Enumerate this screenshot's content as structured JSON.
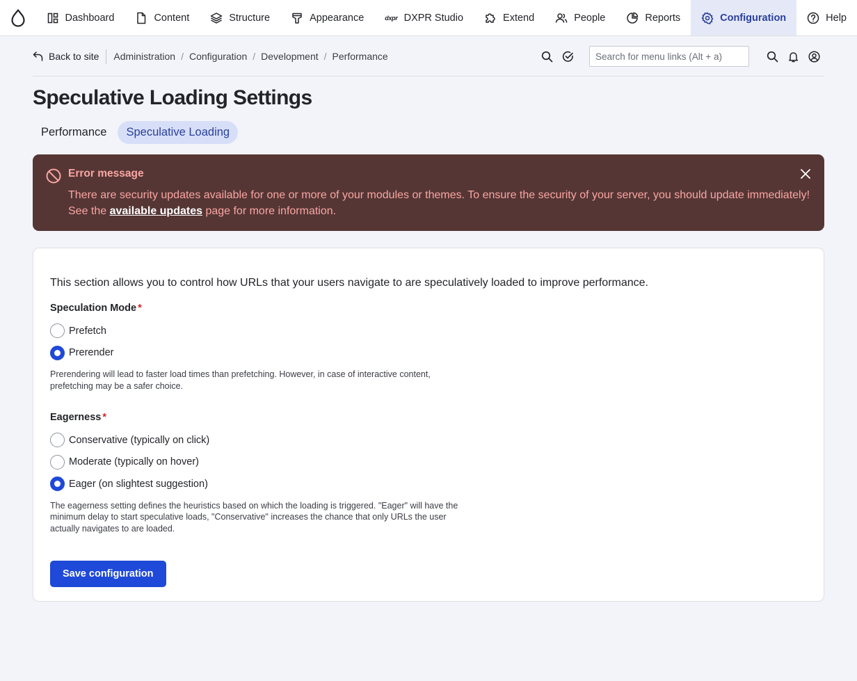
{
  "toolbar": {
    "logo_icon": "drupal-drop-icon",
    "items": [
      {
        "label": "Dashboard",
        "icon": "dashboard-icon"
      },
      {
        "label": "Content",
        "icon": "file-icon"
      },
      {
        "label": "Structure",
        "icon": "layers-icon"
      },
      {
        "label": "Appearance",
        "icon": "brush-icon"
      },
      {
        "label": "DXPR Studio",
        "icon": "dxpr-icon",
        "glyph": "dxpr"
      },
      {
        "label": "Extend",
        "icon": "puzzle-icon"
      },
      {
        "label": "People",
        "icon": "people-icon"
      },
      {
        "label": "Reports",
        "icon": "pie-chart-icon"
      },
      {
        "label": "Configuration",
        "icon": "gear-icon",
        "active": true
      },
      {
        "label": "Help",
        "icon": "help-icon"
      }
    ]
  },
  "breadcrumb": {
    "back_label": "Back to site",
    "items": [
      "Administration",
      "Configuration",
      "Development",
      "Performance"
    ],
    "search_placeholder": "Search for menu links (Alt + a)"
  },
  "page": {
    "title": "Speculative Loading Settings",
    "tabs": [
      {
        "label": "Performance",
        "active": false
      },
      {
        "label": "Speculative Loading",
        "active": true
      }
    ]
  },
  "alert": {
    "title": "Error message",
    "body_before": "There are security updates available for one or more of your modules or themes. To ensure the security of your server, you should update imme­diately! See the ",
    "link_text": "available updates",
    "body_after": " page for more information."
  },
  "form": {
    "intro": "This section allows you to control how URLs that your users navigate to are speculatively loaded to improve performance.",
    "speculation_mode": {
      "label": "Speculation Mode",
      "required_mark": "*",
      "options": [
        {
          "label": "Prefetch",
          "checked": false
        },
        {
          "label": "Prerender",
          "checked": true
        }
      ],
      "description": "Prerendering will lead to faster load times than prefetching. However, in case of interactive content, prefetching may be a safer choice."
    },
    "eagerness": {
      "label": "Eagerness",
      "required_mark": "*",
      "options": [
        {
          "label": "Conservative (typically on click)",
          "checked": false
        },
        {
          "label": "Moderate (typically on hover)",
          "checked": false
        },
        {
          "label": "Eager (on slightest suggestion)",
          "checked": true
        }
      ],
      "description": "The eagerness setting defines the heuristics based on which the loading is triggered. \"Eager\" will have the minimum delay to start speculative loads, \"Conservative\" increases the chance that only URLs the user actually navigates to are loaded."
    },
    "save_label": "Save configuration"
  },
  "colors": {
    "accent": "#1f49d8",
    "active_nav_bg": "#e5e9f7",
    "alert_bg": "#553635",
    "alert_text": "#f9a6a2",
    "required": "#dc2323"
  }
}
